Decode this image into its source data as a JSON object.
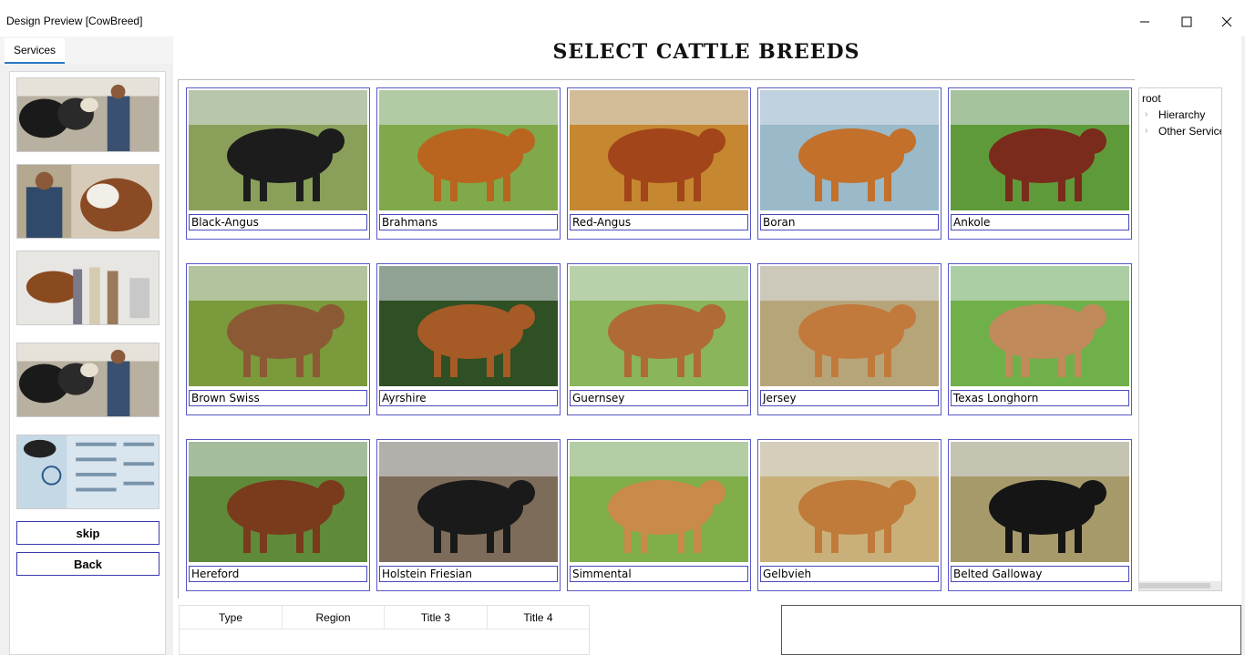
{
  "window": {
    "title": "Design Preview [CowBreed]"
  },
  "tabs": [
    {
      "label": "Services"
    }
  ],
  "heading": "SELECT CATTLE BREEDS",
  "left_panel": {
    "thumbnails": [
      "vet-with-cows",
      "vet-with-calf",
      "horse-exam",
      "vet-with-cows",
      "infographic"
    ],
    "skip_label": "skip",
    "back_label": "Back"
  },
  "breeds": [
    {
      "name": "Black-Angus",
      "color": "#1c1c1c",
      "bg": "#8aa05a"
    },
    {
      "name": "Brahmans",
      "color": "#b9651f",
      "bg": "#7fa94a"
    },
    {
      "name": "Red-Angus",
      "color": "#a2451a",
      "bg": "#c5872f"
    },
    {
      "name": "Boran",
      "color": "#c2702a",
      "bg": "#9ab9c9"
    },
    {
      "name": "Ankole",
      "color": "#7a2b1c",
      "bg": "#5f9a3a"
    },
    {
      "name": "Brown Swiss",
      "color": "#8b5a34",
      "bg": "#7a9a3b"
    },
    {
      "name": "Ayrshire",
      "color": "#a65a26",
      "bg": "#2f4f24"
    },
    {
      "name": "Guernsey",
      "color": "#b06a33",
      "bg": "#8ab55a"
    },
    {
      "name": "Jersey",
      "color": "#c27a3c",
      "bg": "#b7a57a"
    },
    {
      "name": "Texas Longhorn",
      "color": "#c08a5a",
      "bg": "#6fb04a"
    },
    {
      "name": "Hereford",
      "color": "#7a3a1c",
      "bg": "#5f8a3a"
    },
    {
      "name": "Holstein Friesian",
      "color": "#1a1a1a",
      "bg": "#7e6c5a"
    },
    {
      "name": "Simmental",
      "color": "#c98a4a",
      "bg": "#7fae4a"
    },
    {
      "name": "Gelbvieh",
      "color": "#c07a3a",
      "bg": "#c9b07a"
    },
    {
      "name": "Belted Galloway",
      "color": "#151515",
      "bg": "#a79a6a"
    }
  ],
  "tree": {
    "root": "root",
    "children": [
      "Hierarchy",
      "Other Service"
    ]
  },
  "table": {
    "headers": [
      "Type",
      "Region",
      "Title 3",
      "Title 4"
    ]
  }
}
